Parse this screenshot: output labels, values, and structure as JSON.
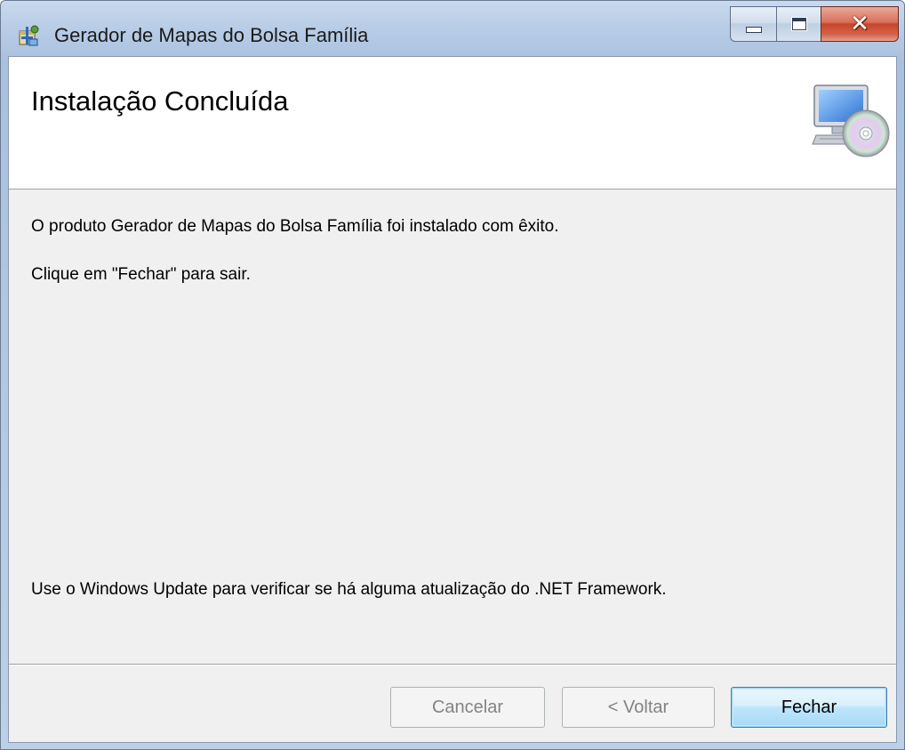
{
  "window": {
    "title": "Gerador de Mapas do Bolsa Família",
    "icon": "installer-package-icon",
    "controls": {
      "minimize": "minimize-icon",
      "maximize": "maximize-icon",
      "close": "close-icon"
    }
  },
  "banner": {
    "title": "Instalação Concluída",
    "icon": "computer-cd-icon"
  },
  "body": {
    "message_installed": "O produto Gerador de Mapas do Bolsa Família foi instalado com êxito.",
    "message_close": "Clique em \"Fechar\" para sair.",
    "message_update": "Use o Windows Update para verificar se há alguma atualização do .NET Framework."
  },
  "buttons": {
    "cancel": "Cancelar",
    "back": "< Voltar",
    "close": "Fechar"
  },
  "colors": {
    "title_bar": "#b8cde6",
    "client_background": "#f0f0f0",
    "banner_background": "#ffffff",
    "close_button": "#c7452a",
    "default_button_border": "#3c7fb1",
    "disabled_text": "#838383"
  }
}
